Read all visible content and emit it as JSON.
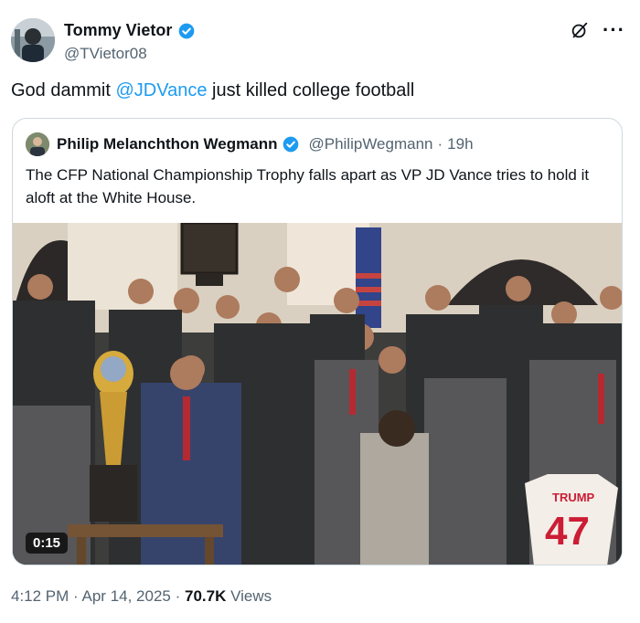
{
  "author": {
    "name": "Tommy Vietor",
    "handle": "@TVietor08"
  },
  "tweet": {
    "text_before": "God dammit ",
    "mention": "@JDVance",
    "text_after": " just killed college football"
  },
  "quoted": {
    "name": "Philip Melanchthon Wegmann",
    "handle": "@PhilipWegmann",
    "separator": "·",
    "time": "19h",
    "text": "The CFP National Championship Trophy falls apart as VP JD Vance tries to hold it aloft at the White House.",
    "video": {
      "duration": "0:15",
      "jersey_name": "TRUMP",
      "jersey_number": "47"
    }
  },
  "meta": {
    "time": "4:12 PM",
    "dot": "·",
    "date": "Apr 14, 2025",
    "views_count": "70.7K",
    "views_label": "Views"
  },
  "colors": {
    "link": "#1d9bf0",
    "secondary_text": "#536471",
    "primary_text": "#0f1419",
    "border": "#cfd9de"
  },
  "icons": [
    "verified-badge-icon",
    "grok-icon",
    "more-options-icon"
  ]
}
